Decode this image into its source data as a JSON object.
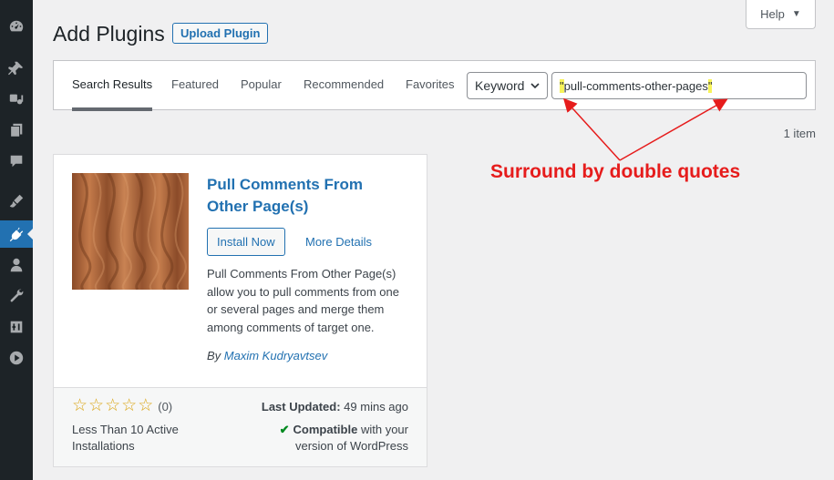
{
  "header": {
    "title": "Add Plugins",
    "upload_label": "Upload Plugin",
    "help_label": "Help"
  },
  "sidebar": {
    "items": [
      {
        "icon": "dashboard-icon"
      },
      {
        "icon": "pin-icon"
      },
      {
        "icon": "media-icon"
      },
      {
        "icon": "pages-icon"
      },
      {
        "icon": "comments-icon"
      },
      {
        "icon": "appearance-icon"
      },
      {
        "icon": "plugins-icon",
        "active": true
      },
      {
        "icon": "users-icon"
      },
      {
        "icon": "tools-icon"
      },
      {
        "icon": "settings-icon"
      },
      {
        "icon": "play-icon"
      }
    ]
  },
  "filter": {
    "tabs": [
      {
        "label": "Search Results",
        "current": true
      },
      {
        "label": "Featured"
      },
      {
        "label": "Popular"
      },
      {
        "label": "Recommended"
      },
      {
        "label": "Favorites"
      }
    ],
    "search_type": "Keyword",
    "search_value": "\"pull-comments-other-pages\"",
    "search_quote": "\"",
    "search_term": "pull-comments-other-pages"
  },
  "results": {
    "count": "1 item"
  },
  "annotation": {
    "text": "Surround by double quotes",
    "color": "#e61c1c"
  },
  "plugin": {
    "name": "Pull Comments From Other Page(s)",
    "install_label": "Install Now",
    "more_details_label": "More Details",
    "description": "Pull Comments From Other Page(s) allow you to pull comments from one or several pages and merge them among comments of target one.",
    "author_prefix": "By",
    "author": "Maxim Kudryavtsev",
    "rating_stars": 0,
    "rating_max": 5,
    "rating_count": "(0)",
    "installs": "Less Than 10 Active Installations",
    "last_updated_label": "Last Updated:",
    "last_updated_value": "49 mins ago",
    "compat_strong": "Compatible",
    "compat_rest_1": "with your",
    "compat_rest_2": "version of WordPress"
  }
}
